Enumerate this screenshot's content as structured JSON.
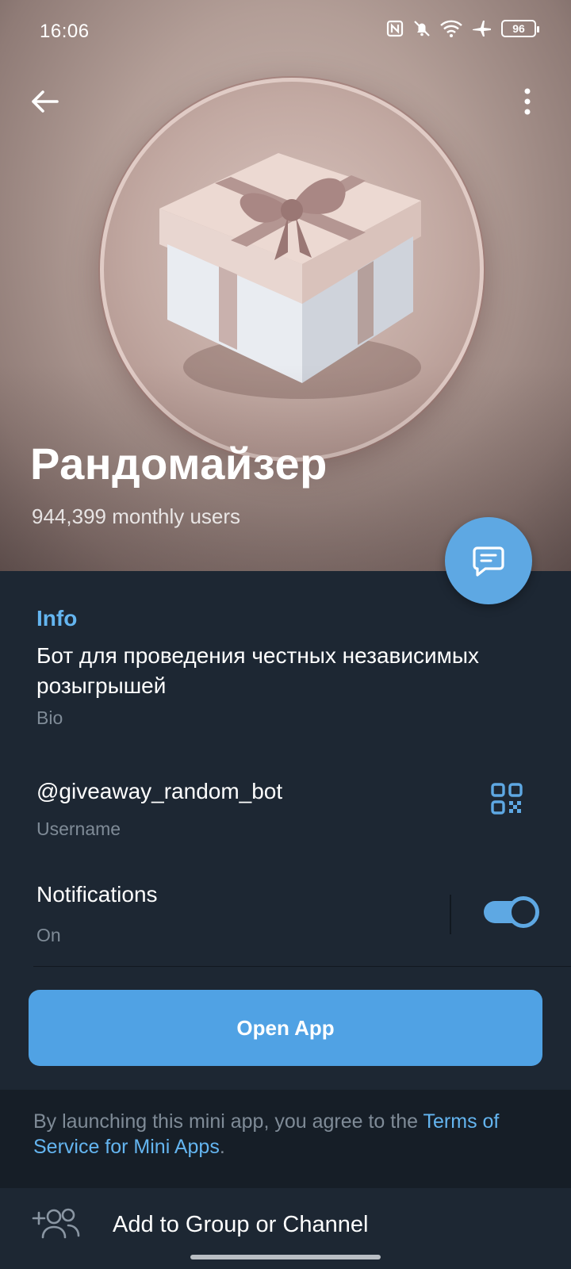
{
  "status_bar": {
    "time": "16:06",
    "battery": "96",
    "icons": [
      "nfc-icon",
      "bell-muted-icon",
      "wifi-icon",
      "airplane-icon",
      "battery-icon"
    ]
  },
  "header": {
    "back_icon": "back-arrow-icon",
    "menu_icon": "more-vertical-icon"
  },
  "profile": {
    "name": "Рандомайзер",
    "subtitle": "944,399 monthly users",
    "avatar": "gift-box-image"
  },
  "fab": {
    "icon": "message-icon"
  },
  "info": {
    "section_title": "Info",
    "bio": "Бот для проведения честных независимых розыгрышей",
    "bio_label": "Bio",
    "username": "@giveaway_random_bot",
    "username_label": "Username",
    "qr_icon": "qr-code-icon",
    "notifications": "Notifications",
    "notifications_state": "On",
    "notifications_enabled": true
  },
  "open_app_label": "Open App",
  "terms": {
    "prefix": "By launching this mini app, you agree to the ",
    "link": "Terms of Service for Mini Apps",
    "suffix": "."
  },
  "add_to_group": {
    "label": "Add to Group or Channel",
    "icon": "add-user-icon"
  },
  "colors": {
    "background": "#1d2733",
    "accent": "#5ea8e3",
    "link": "#64b5f0",
    "secondary_text": "#7f8b97"
  }
}
